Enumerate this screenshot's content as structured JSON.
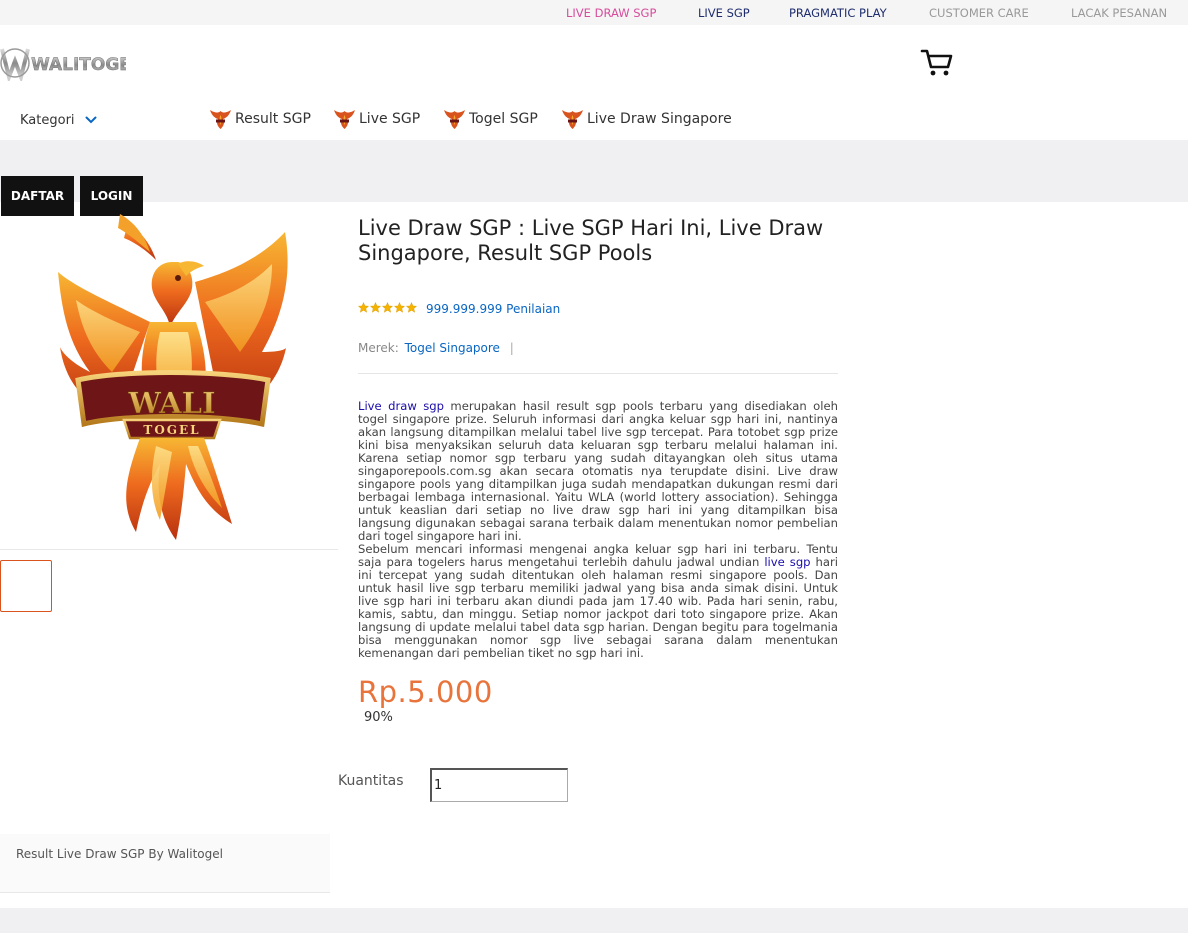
{
  "topbar": {
    "links": [
      {
        "label": "LIVE DRAW SGP",
        "color": "#d64d9c"
      },
      {
        "label": "LIVE SGP",
        "color": "#1f2d6e"
      },
      {
        "label": "PRAGMATIC PLAY",
        "color": "#1f2d6e"
      },
      {
        "label": "CUSTOMER CARE",
        "color": "#999999"
      },
      {
        "label": "LACAK PESANAN",
        "color": "#999999"
      }
    ]
  },
  "header": {
    "logo_text": "WALITOGEL",
    "cart_icon": "cart-icon"
  },
  "nav": {
    "kategori_label": "Kategori",
    "links": [
      "Result SGP",
      "Live SGP",
      "Togel SGP",
      "Live Draw Singapore"
    ]
  },
  "auth": {
    "daftar_label": "DAFTAR",
    "login_label": "LOGIN"
  },
  "product": {
    "image_text_main": "WALI",
    "image_text_sub": "TOGEL",
    "title": "Live Draw SGP : Live SGP Hari Ini, Live Draw Singapore, Result SGP Pools",
    "stars": 5,
    "rating_text": "999.999.999 Penilaian",
    "brand_label": "Merek:",
    "brand_value": "Togel Singapore",
    "brand_sep": "|",
    "desc_p1_link": "Live draw sgp",
    "desc_p1_rest": " merupakan hasil result sgp pools terbaru yang disediakan oleh togel singapore prize. Seluruh informasi dari angka keluar sgp hari ini, nantinya akan langsung ditampilkan melalui tabel live sgp tercepat. Para totobet sgp prize kini bisa menyaksikan seluruh data keluaran sgp terbaru melalui halaman ini. Karena setiap nomor sgp terbaru yang sudah ditayangkan oleh situs utama singaporepools.com.sg akan secara otomatis nya terupdate disini. Live draw singapore pools yang ditampilkan juga sudah mendapatkan dukungan resmi dari berbagai lembaga internasional. Yaitu WLA (world lottery association). Sehingga untuk keaslian dari setiap no live draw sgp hari ini yang ditampilkan bisa langsung digunakan sebagai sarana terbaik dalam menentukan nomor pembelian dari togel singapore hari ini.",
    "desc_p2_start": "Sebelum mencari informasi mengenai angka keluar sgp hari ini terbaru. Tentu saja para togelers harus mengetahui terlebih dahulu jadwal undian ",
    "desc_p2_link": "live sgp",
    "desc_p2_rest": " hari ini tercepat yang sudah ditentukan oleh halaman resmi singapore pools. Dan untuk hasil live sgp terbaru memiliki jadwal yang bisa anda simak disini. Untuk live sgp hari ini terbaru akan diundi pada jam 17.40 wib. Pada hari senin, rabu, kamis, sabtu, dan minggu. Setiap nomor jackpot dari toto singapore prize. Akan langsung di update melalui tabel data sgp harian. Dengan begitu para togelmania bisa menggunakan nomor sgp live sebagai sarana dalam menentukan kemenangan dari pembelian tiket no sgp hari ini.",
    "price": "Rp.5.000",
    "discount": "90%",
    "quantity_label": "Kuantitas",
    "quantity_value": "1"
  },
  "caption": "Result Live Draw SGP By Walitogel",
  "colors": {
    "price": "#e8743b",
    "link": "#0a66c2",
    "auth_bg": "#111111"
  }
}
